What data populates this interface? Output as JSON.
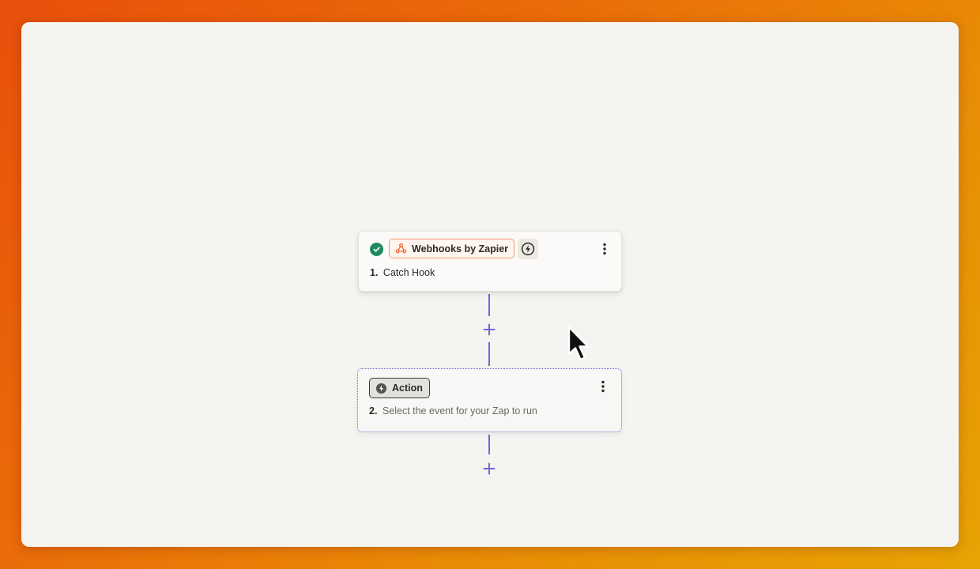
{
  "workflow": {
    "trigger": {
      "app_name": "Webhooks by Zapier",
      "step_number": "1.",
      "step_title": "Catch Hook",
      "status": "complete"
    },
    "action": {
      "badge_label": "Action",
      "step_number": "2.",
      "step_hint": "Select the event for your Zap to run"
    }
  },
  "colors": {
    "accent": "#6d66d8",
    "success": "#1e8a5e",
    "webhook_orange": "#f0642d"
  },
  "icons": {
    "status": "check-circle-icon",
    "app": "webhook-icon",
    "trigger_type": "bolt-icon",
    "menu": "kebab-menu-icon",
    "action_type": "action-bolt-icon",
    "add_step": "plus-icon"
  }
}
